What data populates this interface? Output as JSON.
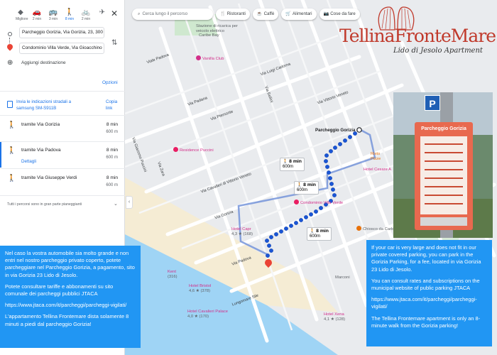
{
  "panel": {
    "modes": [
      {
        "icon": "best-route-icon",
        "label": "Migliore",
        "glyph": "◆"
      },
      {
        "icon": "car-icon",
        "label": "2 min",
        "glyph": "🚗"
      },
      {
        "icon": "bus-icon",
        "label": "3 min",
        "glyph": "🚌"
      },
      {
        "icon": "walk-icon",
        "label": "8 min",
        "glyph": "🚶"
      },
      {
        "icon": "bike-icon",
        "label": "2 min",
        "glyph": "🚲"
      },
      {
        "icon": "plane-icon",
        "label": "",
        "glyph": "✈"
      }
    ],
    "origin": "Parcheggio Gorizia, Via Gorizia, 23, 300",
    "destination": "Condominio Villa Verde, Via Gioacchino",
    "add_destination": "Aggiungi destinazione",
    "options": "Opzioni",
    "send_label": "Invia le indicazioni stradali a samsung SM-S911B",
    "copy_label": "Copia link",
    "routes": [
      {
        "name": "tramite Via Gorizia",
        "time": "8 min",
        "distance": "600 m"
      },
      {
        "name": "tramite Via Padova",
        "time": "8 min",
        "distance": "600 m",
        "details": "Dettagli"
      },
      {
        "name": "tramite Via Giuseppe Verdi",
        "time": "8 min",
        "distance": "600 m"
      }
    ],
    "note": "Tutti i percorsi sono in gran parte pianeggianti"
  },
  "map": {
    "search_placeholder": "Cerca lungo il percorso",
    "chips": [
      {
        "icon": "restaurant-icon",
        "glyph": "🍴",
        "label": "Ristoranti"
      },
      {
        "icon": "coffee-icon",
        "glyph": "☕",
        "label": "Caffè"
      },
      {
        "icon": "grocery-icon",
        "glyph": "🛒",
        "label": "Alimentari"
      },
      {
        "icon": "camera-icon",
        "glyph": "📷",
        "label": "Cose da fare"
      }
    ],
    "streets": [
      "Via Padana",
      "Via Luigi Cadorna",
      "Via Piemonte",
      "Via Vittorio Veneto",
      "Viale Padova",
      "Via Zara",
      "Via Gorizia",
      "Via Cesare Battisti",
      "Via Bellini",
      "Via Cavalieri di Vittorio Veneto",
      "Via Giacomo Puccini",
      "Via Leone Fornasiero",
      "Via Gioacchino Rossini",
      "Via Ada Negri",
      "Via Padova",
      "Lungomare Sile"
    ],
    "pois": {
      "charging": "Stazione di ricarica per veicolo elettrico",
      "caribe": "Caribe Bay",
      "vanilla": "Vanilla Club",
      "residence": "Residence Puccini",
      "parking": "Parcheggio Gorizia",
      "condominio": "Condominio Villa Verde",
      "hotel_cesare": "Hotel Cesare A",
      "chiosco": "Chiosco da Carlo",
      "bristol": "Hotel Bristol",
      "bristol_rating": "4,6 ★ (378)",
      "palace": "Hotel Cavalieri Palace",
      "palace_rating": "4,0 ★ (170)",
      "marconi": "Marconi",
      "ristorante": "Risto Pizze",
      "hotel_other": "Hotel Capr",
      "hotel_other_rating": "4,3 ★ (168)",
      "hotel_xena": "Hotel Xena",
      "hotel_xena_rating": "4,1 ★ (128)",
      "kent": "Kent",
      "kent_rating": "(316)"
    },
    "tooltips": [
      {
        "time": "8 min",
        "dist": "600m"
      },
      {
        "time": "8 min",
        "dist": "600m"
      },
      {
        "time": "8 min",
        "dist": "600m"
      }
    ]
  },
  "logo": {
    "title": "TellinaFronteMare",
    "subtitle": "Lido di Jesolo Apartment"
  },
  "photo": {
    "board_title": "Parcheggio Gorizia",
    "sign": "P"
  },
  "info_it": [
    "Nel caso la vostra automobile sia molto grande e non entri nel nostro parcheggio privato coperto, potete parcheggiare nel Parcheggio Gorizia, a pagamento, sito in via Gorizia 23 Lido di Jesolo.",
    "Potete consultare tariffe e abbonamenti su sito comunale dei parcheggi pubblici JTACA",
    "https://www.jtaca.com/it/parcheggi/parcheggi-vigilati/",
    "L'appartamento Tellina Frontemare dista solamente 8 minuti a piedi dal parcheggio Gorizia!"
  ],
  "info_en": [
    "If your car is very large and does not fit in our private covered parking, you can park in the Gorizia Parking, for a fee, located in via Gorizia 23 Lido di Jesolo.",
    "You can consult rates and subscriptions on the municipal website of public parking JTACA",
    "https://www.jtaca.com/it/parcheggi/parcheggi-vigilati/",
    "The Tellina Frontemare apartment is only an 8-minute walk from the Gorizia parking!"
  ],
  "colors": {
    "accent": "#1a73e8",
    "info_box": "#2196f3",
    "route": "#1a56d6",
    "logo": "#c0392b"
  }
}
